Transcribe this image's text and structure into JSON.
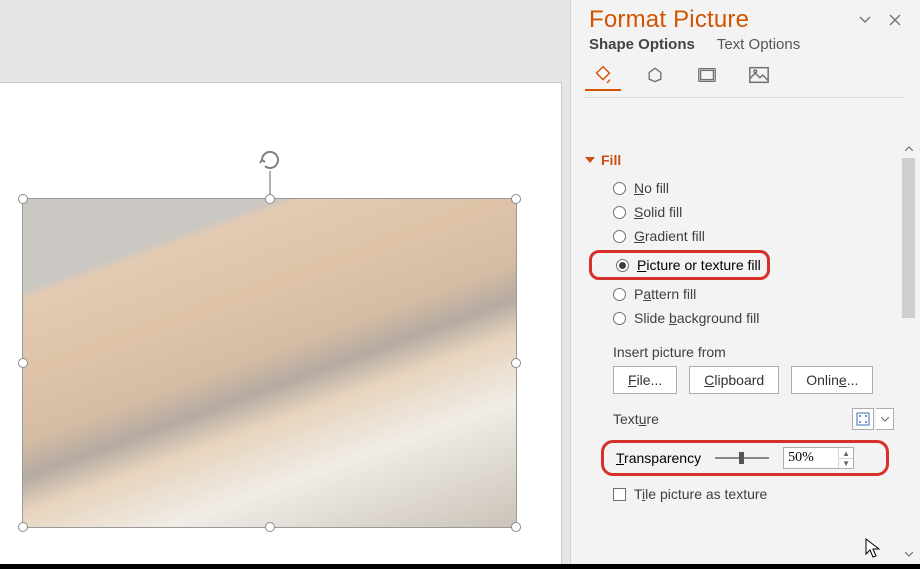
{
  "pane": {
    "title": "Format Picture",
    "tabs": {
      "shape": "Shape Options",
      "text": "Text Options"
    }
  },
  "section": {
    "fill": "Fill"
  },
  "fill": {
    "noFill": {
      "accel": "N",
      "rest": "o fill"
    },
    "solidFill": {
      "accel": "S",
      "rest": "olid fill"
    },
    "gradientFill": {
      "accel": "G",
      "rest": "radient fill"
    },
    "pictureFill": {
      "accel": "P",
      "rest": "icture or texture fill"
    },
    "patternFill": {
      "pre": "P",
      "accel": "a",
      "rest": "ttern fill"
    },
    "slideBgFill": {
      "pre": "Slide ",
      "accel": "b",
      "rest": "ackground fill"
    }
  },
  "insert": {
    "label": "Insert picture from",
    "file": {
      "accel": "F",
      "rest": "ile..."
    },
    "clipboard": {
      "accel": "C",
      "rest": "lipboard"
    },
    "online": {
      "pre": "Onlin",
      "accel": "e",
      "rest": "..."
    }
  },
  "texture": {
    "pre": "Text",
    "accel": "u",
    "rest": "re"
  },
  "transparency": {
    "accel": "T",
    "rest": "ransparency",
    "value": "50%"
  },
  "tile": {
    "pre": "T",
    "accel": "i",
    "rest": "le picture as texture"
  }
}
